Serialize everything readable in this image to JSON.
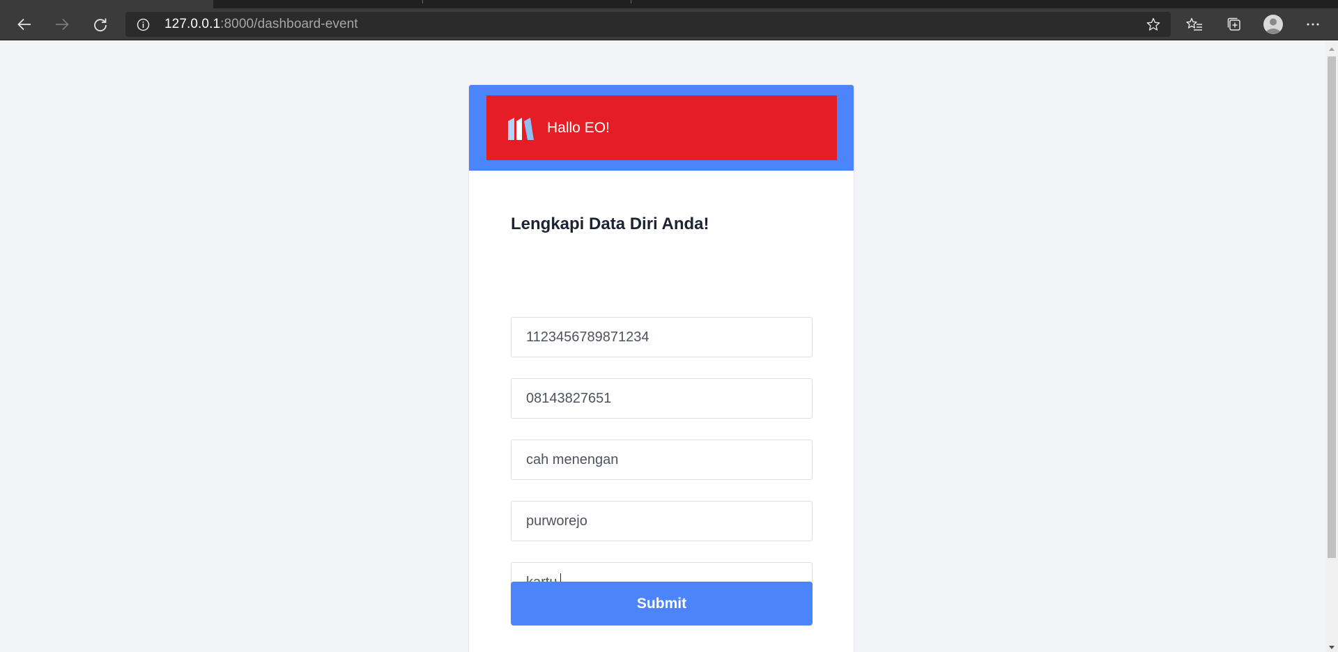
{
  "browser": {
    "url_host": "127.0.0.1",
    "url_path": ":8000/dashboard-event",
    "icons": {
      "back": "back-arrow-icon",
      "forward": "forward-arrow-icon",
      "refresh": "refresh-icon",
      "site_info": "info-icon",
      "favorite": "star-icon",
      "favorites_list": "favorites-icon",
      "collections": "collections-icon",
      "profile": "profile-icon",
      "menu": "more-icon"
    }
  },
  "header": {
    "greeting": "Hallo EO!",
    "logo_icon": "bookshelf-logo-icon"
  },
  "form": {
    "title": "Lengkapi Data Diri Anda!",
    "fields": [
      {
        "value": "1123456789871234"
      },
      {
        "value": "08143827651"
      },
      {
        "value": "cah menengan"
      },
      {
        "value": "purworejo"
      },
      {
        "value": "kartu"
      }
    ],
    "submit_label": "Submit"
  },
  "colors": {
    "header_blue": "#4c84fc",
    "header_red": "#e51d24",
    "submit_blue": "#4c84fc",
    "page_background": "#f3f4f8"
  }
}
